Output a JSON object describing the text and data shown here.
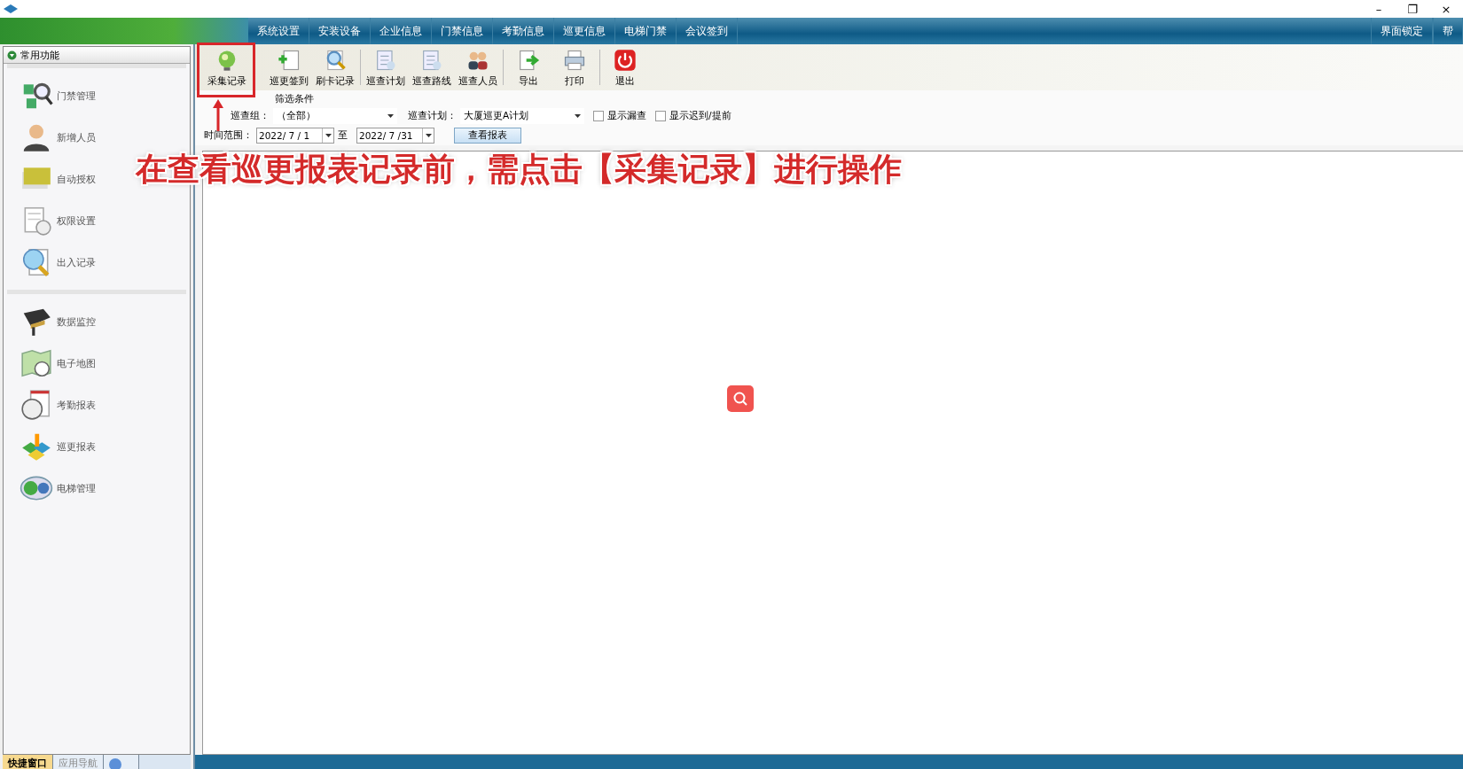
{
  "window": {
    "controls": [
      "–",
      "❐",
      "×"
    ]
  },
  "menu_bar": {
    "items": [
      "系统设置",
      "安装设备",
      "企业信息",
      "门禁信息",
      "考勤信息",
      "巡更信息",
      "电梯门禁",
      "会议签到"
    ],
    "right_items": [
      "界面锁定",
      "帮"
    ]
  },
  "sidebar": {
    "header": "常用功能",
    "groups": [
      [
        "门禁管理",
        "新增人员",
        "自动授权",
        "权限设置",
        "出入记录"
      ],
      [
        "数据监控",
        "电子地图",
        "考勤报表",
        "巡更报表",
        "电梯管理"
      ]
    ],
    "bottom_tabs": [
      {
        "label": "快捷窗口",
        "selected": true
      },
      {
        "label": "应用导航",
        "selected": false
      },
      {
        "kind": "help",
        "selected": false
      }
    ]
  },
  "toolbar": {
    "groups": [
      [
        "采集记录",
        "巡更签到",
        "刷卡记录"
      ],
      [
        "巡查计划",
        "巡查路线",
        "巡查人员"
      ],
      [
        "导出",
        "打印"
      ],
      [
        "退出"
      ]
    ]
  },
  "filter": {
    "title": "筛选条件",
    "group_label": "巡查组：",
    "group_value": "（全部）",
    "plan_label": "巡查计划：",
    "plan_value": "大厦巡更A计划",
    "checkboxes": [
      {
        "label": "显示漏查",
        "checked": false
      },
      {
        "label": "显示迟到/提前",
        "checked": false
      }
    ],
    "range_label": "时间范围：",
    "date_from": "2022/ 7 / 1",
    "to_label": "至",
    "date_to": "2022/ 7 /31",
    "button": "查看报表"
  },
  "annotation": {
    "text": "在查看巡更报表记录前，需点击【采集记录】进行操作"
  }
}
